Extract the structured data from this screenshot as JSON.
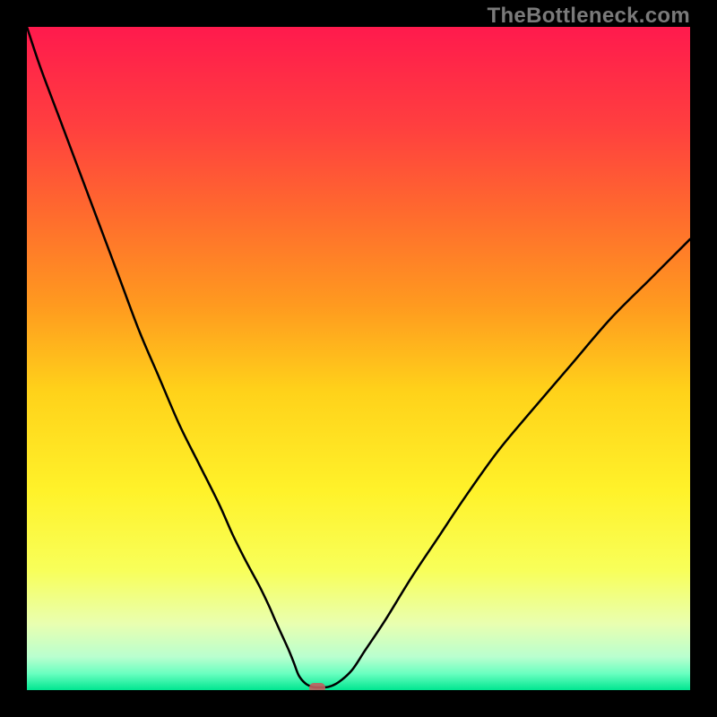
{
  "watermark": "TheBottleneck.com",
  "chart_data": {
    "type": "line",
    "title": "",
    "xlabel": "",
    "ylabel": "",
    "xlim": [
      0,
      100
    ],
    "ylim": [
      0,
      100
    ],
    "x": [
      0,
      2,
      5,
      8,
      11,
      14,
      17,
      20,
      23,
      26,
      29,
      31,
      33,
      35,
      36.5,
      37.5,
      38.5,
      39.5,
      40.3,
      41,
      42,
      43,
      43.8,
      45.5,
      47,
      49,
      51,
      54,
      58,
      62,
      66,
      71,
      76,
      82,
      88,
      94,
      100
    ],
    "values": [
      100,
      94,
      86,
      78,
      70,
      62,
      54,
      47,
      40,
      34,
      28,
      23.5,
      19.5,
      15.8,
      12.7,
      10.4,
      8.2,
      6.0,
      4.0,
      2.2,
      1.0,
      0.5,
      0.4,
      0.5,
      1.2,
      3.0,
      6.0,
      10.5,
      17,
      23,
      29,
      36,
      42,
      49,
      56,
      62,
      68
    ],
    "marker": {
      "x": 43.8,
      "y": 0.4
    },
    "background_gradient_stops": [
      {
        "pos": 0.0,
        "color": "#ff1a4d"
      },
      {
        "pos": 0.15,
        "color": "#ff3f3f"
      },
      {
        "pos": 0.28,
        "color": "#ff6a2e"
      },
      {
        "pos": 0.42,
        "color": "#ff9a1f"
      },
      {
        "pos": 0.55,
        "color": "#ffd21a"
      },
      {
        "pos": 0.7,
        "color": "#fff22a"
      },
      {
        "pos": 0.82,
        "color": "#f8ff5a"
      },
      {
        "pos": 0.9,
        "color": "#e9ffb0"
      },
      {
        "pos": 0.95,
        "color": "#b9ffcf"
      },
      {
        "pos": 0.975,
        "color": "#6affc0"
      },
      {
        "pos": 1.0,
        "color": "#00e690"
      }
    ]
  }
}
